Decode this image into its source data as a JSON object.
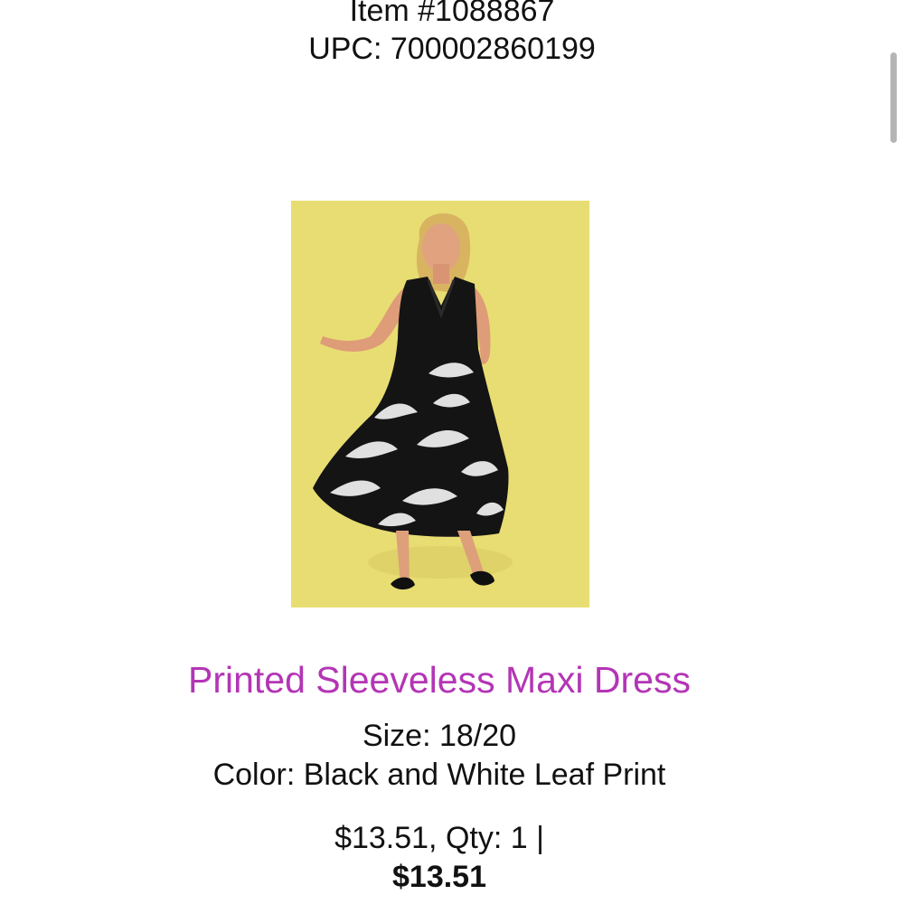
{
  "item": {
    "number_text": "Item #1088867",
    "upc_text": "UPC: 700002860199"
  },
  "product": {
    "title": "Printed Sleeveless Maxi Dress",
    "size_text": "Size: 18/20",
    "color_text": "Color: Black and White Leaf Print",
    "price_qty_text": "$13.51, Qty: 1 |",
    "total_text": "$13.51",
    "image": {
      "background_color": "#e8dd72",
      "dress_color": "#141414",
      "print_color": "#f2f2f2"
    }
  },
  "colors": {
    "title": "#b335b5",
    "text": "#111111",
    "scrollbar": "#b5b5b5"
  }
}
